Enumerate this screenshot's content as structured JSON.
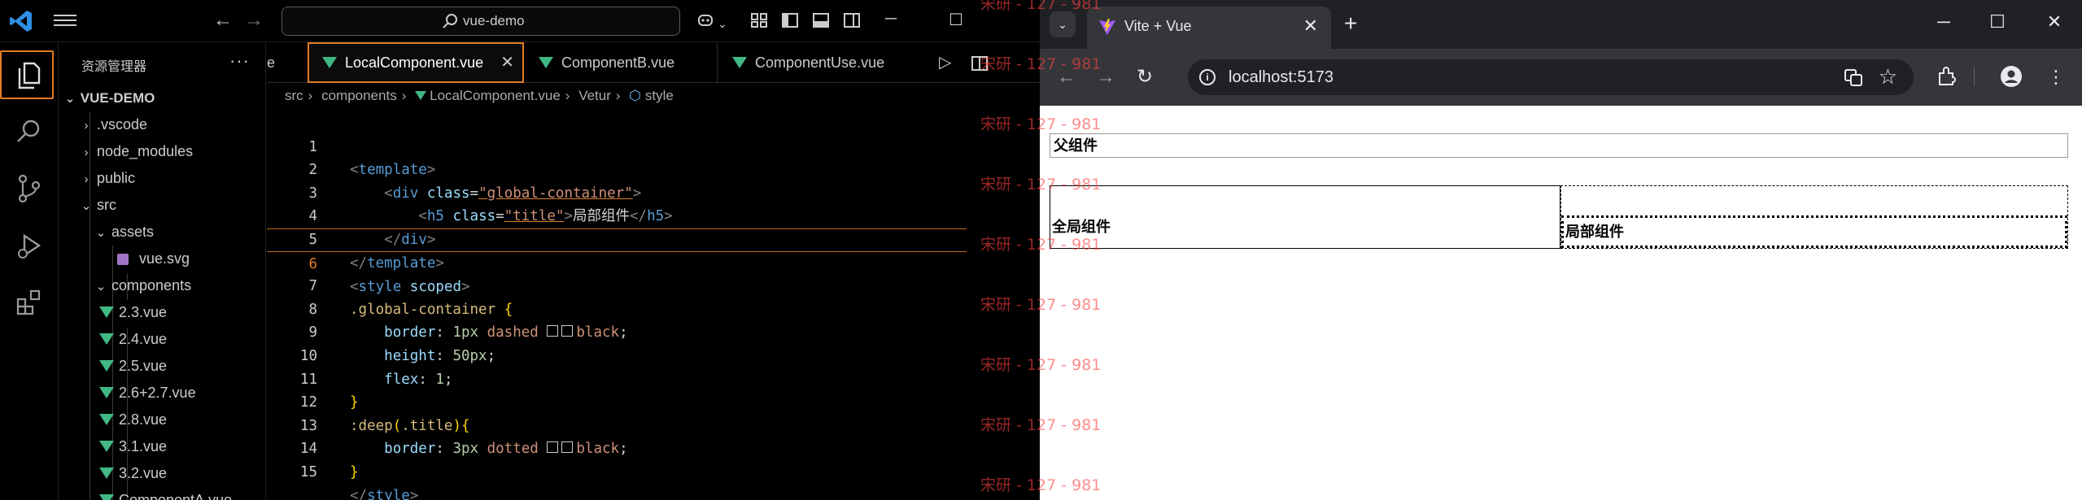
{
  "vscode": {
    "search": "vue-demo",
    "sidebar": {
      "header": "资源管理器",
      "more": "···",
      "root": "VUE-DEMO",
      "items": [
        {
          "label": ".vscode",
          "chev": "›"
        },
        {
          "label": "node_modules",
          "chev": "›"
        },
        {
          "label": "public",
          "chev": "›"
        },
        {
          "label": "src",
          "chev": "⌄"
        },
        {
          "label": "assets",
          "chev": "⌄"
        },
        {
          "label": "vue.svg"
        },
        {
          "label": "components",
          "chev": "⌄"
        },
        {
          "label": "2.3.vue"
        },
        {
          "label": "2.4.vue"
        },
        {
          "label": "2.5.vue"
        },
        {
          "label": "2.6+2.7.vue"
        },
        {
          "label": "2.8.vue"
        },
        {
          "label": "3.1.vue"
        },
        {
          "label": "3.2.vue"
        },
        {
          "label": "ComponentA.vue"
        }
      ]
    },
    "tabs": [
      {
        "label": "e"
      },
      {
        "label": "LocalComponent.vue",
        "active": true
      },
      {
        "label": "ComponentB.vue"
      },
      {
        "label": "ComponentUse.vue"
      }
    ],
    "breadcrumb": [
      "src",
      "components",
      "LocalComponent.vue",
      "Vetur",
      "style"
    ],
    "current_line": 6,
    "code_lines": [
      "1",
      "2",
      "3",
      "4",
      "5",
      "6",
      "7",
      "8",
      "9",
      "10",
      "11",
      "12",
      "13",
      "14",
      "15"
    ],
    "code": {
      "template_open": "template",
      "div_tag": "div",
      "class_attr": "class",
      "class_val_global": "\"global-container\"",
      "h5_tag": "h5",
      "class_val_title": "\"title\"",
      "h5_text": "局部组件",
      "style_tag": "style",
      "scoped": "scoped",
      "sel_global": ".global-container",
      "prop_border": "border",
      "val_1px": "1px",
      "val_dashed": "dashed",
      "val_black": "black",
      "prop_height": "height",
      "val_50px": "50px",
      "prop_flex": "flex",
      "val_1": "1",
      "sel_deep": ":deep",
      "sel_title": ".title",
      "val_3px": "3px",
      "val_dotted": "dotted"
    }
  },
  "watermark": "宋研 - 127 - 981",
  "chrome": {
    "tab_title": "Vite + Vue",
    "url": "localhost:5173",
    "page": {
      "parent_label": "父组件",
      "global_label": "全局组件",
      "local_label": "局部组件"
    }
  }
}
